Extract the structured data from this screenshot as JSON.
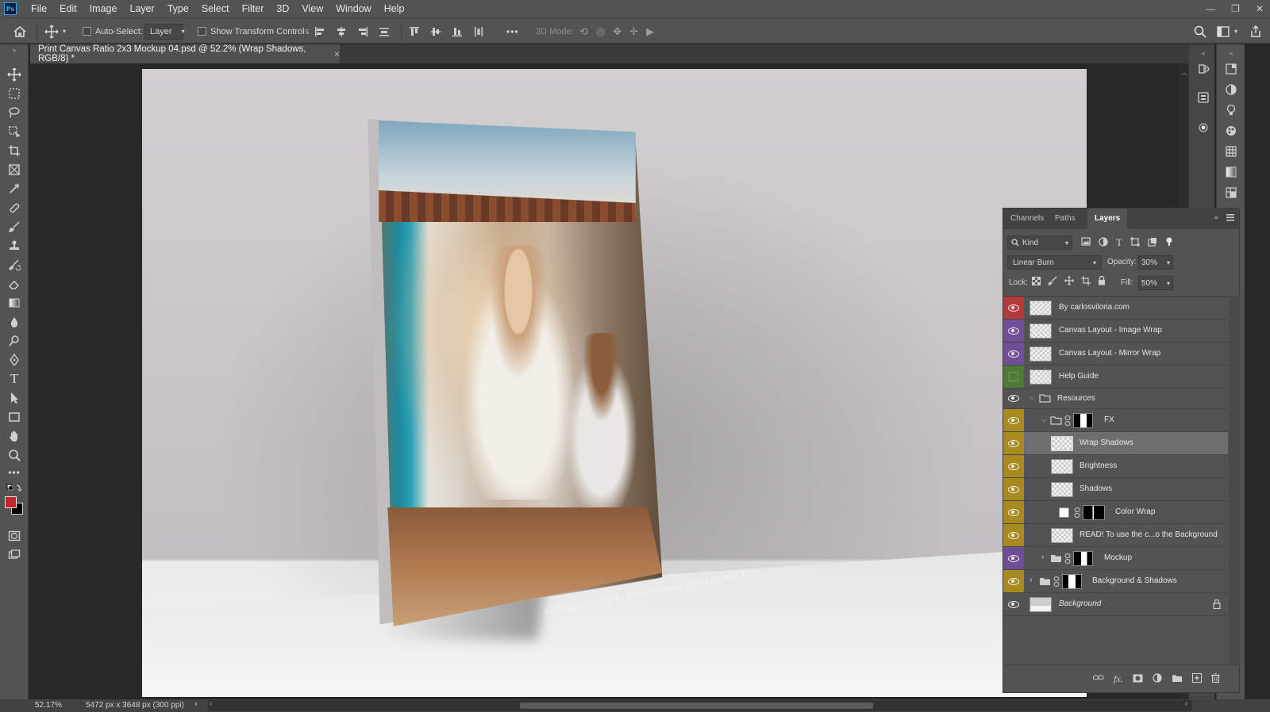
{
  "app": {
    "logo": "Ps"
  },
  "menu": [
    "File",
    "Edit",
    "Image",
    "Layer",
    "Type",
    "Select",
    "Filter",
    "3D",
    "View",
    "Window",
    "Help"
  ],
  "options": {
    "auto_select_label": "Auto-Select:",
    "auto_select_value": "Layer",
    "show_transform_label": "Show Transform Controls",
    "more": "•••",
    "mode_3d_label": "3D Mode:"
  },
  "document": {
    "tab_title": "Print Canvas Ratio 2x3 Mockup 04.psd @ 52.2% (Wrap Shadows, RGB/8) *",
    "close": "×",
    "watermark": "BY CARLOS VILORIA - PRINT CANVAS RATIO 2:3 MOCKUP"
  },
  "layers_panel": {
    "tabs": [
      "Channels",
      "Paths",
      "Layers"
    ],
    "active_tab": "Layers",
    "filter_kind": "Kind",
    "blend_mode": "Linear Burn",
    "opacity_label": "Opacity:",
    "opacity_value": "30%",
    "lock_label": "Lock:",
    "fill_label": "Fill:",
    "fill_value": "50%",
    "layers": [
      {
        "name": "By carlosviloria.com",
        "color": "#b33b3b"
      },
      {
        "name": "Canvas Layout - Image Wrap",
        "color": "#6f4f96"
      },
      {
        "name": "Canvas Layout - Mirror Wrap",
        "color": "#6f4f96"
      },
      {
        "name": "Help Guide",
        "color": "#4f7a3a"
      },
      {
        "name": "Resources",
        "color": "#535353"
      },
      {
        "name": "FX",
        "color": "#a98a1f"
      },
      {
        "name": "Wrap Shadows",
        "color": "#a98a1f"
      },
      {
        "name": "Brightness",
        "color": "#a98a1f"
      },
      {
        "name": "Shadows",
        "color": "#a98a1f"
      },
      {
        "name": "Color Wrap",
        "color": "#a98a1f"
      },
      {
        "name": "READ! To use the c...o the Background",
        "color": "#a98a1f"
      },
      {
        "name": "Mockup",
        "color": "#6f4f96"
      },
      {
        "name": "Background & Shadows",
        "color": "#a98a1f"
      },
      {
        "name": "Background",
        "color": "#535353"
      }
    ]
  },
  "status": {
    "zoom": "52.17%",
    "doc_info": "5472 px x 3648 px (300 ppi)"
  }
}
